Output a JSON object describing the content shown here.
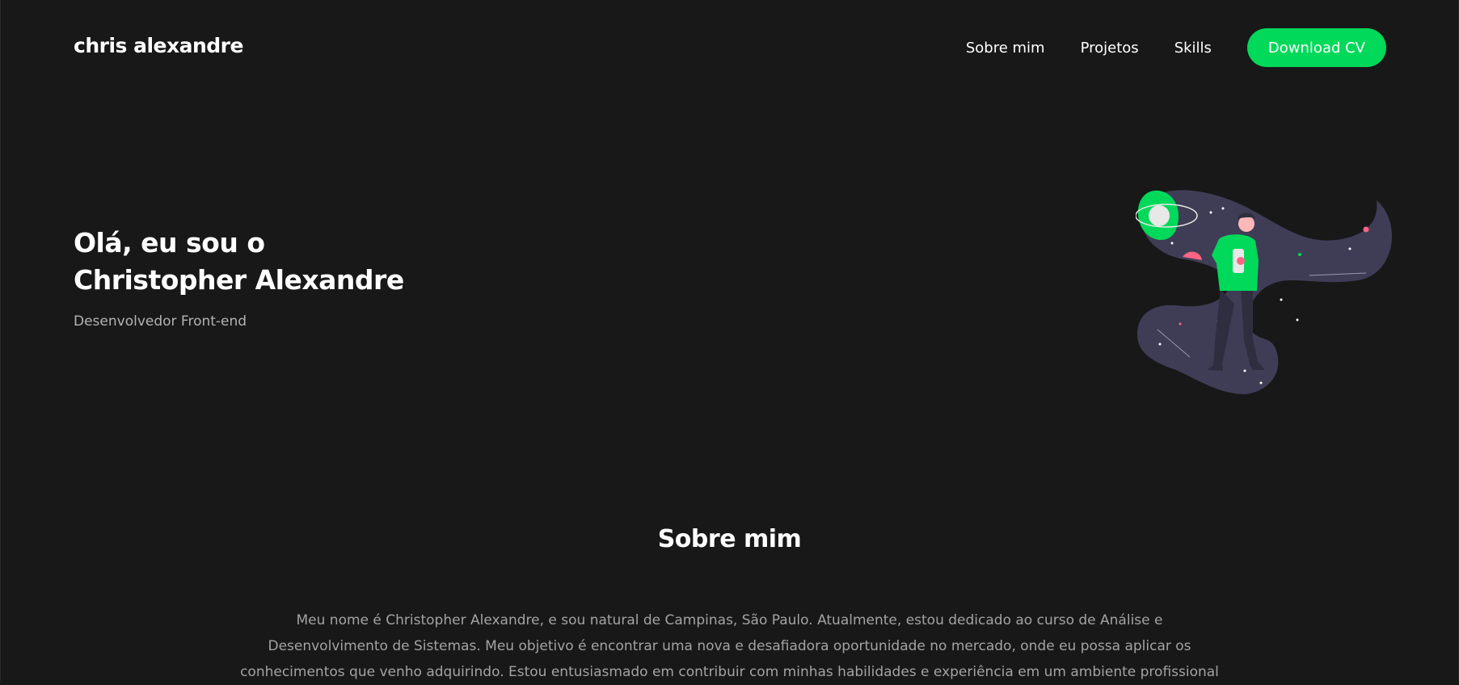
{
  "header": {
    "brand": "chris alexandre",
    "nav": [
      "Sobre mim",
      "Projetos",
      "Skills"
    ],
    "cta_label": "Download CV"
  },
  "hero": {
    "greeting": "Olá, eu sou o",
    "name": "Christopher Alexandre",
    "subtitle": "Desenvolvedor Front-end",
    "illustration": "person-in-space-illustration"
  },
  "about": {
    "title": "Sobre mim",
    "line1": "Meu nome é Christopher Alexandre, e sou natural de Campinas, São Paulo. Atualmente, estou dedicado ao curso de Análise e",
    "line2": "Desenvolvimento de Sistemas. Meu objetivo é encontrar uma nova e desafiadora oportunidade no mercado, onde eu possa aplicar os",
    "line3": "conhecimentos que venho adquirindo. Estou entusiasmado em contribuir com minhas habilidades e experiência em um ambiente profissional"
  },
  "colors": {
    "background": "#181818",
    "accent": "#00d95a",
    "muted_text": "#a3a3a3",
    "illustration_blob": "#3f3d56",
    "illustration_pink": "#ff6584"
  }
}
